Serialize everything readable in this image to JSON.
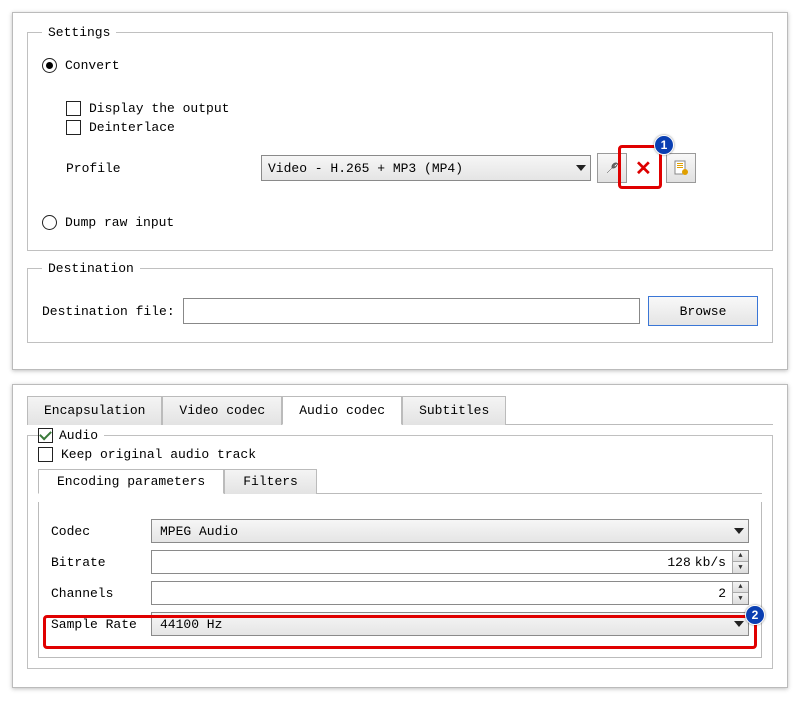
{
  "settings": {
    "legend": "Settings",
    "convert_label": "Convert",
    "display_output_label": "Display the output",
    "deinterlace_label": "Deinterlace",
    "profile_label": "Profile",
    "profile_value": "Video - H.265 + MP3 (MP4)",
    "dump_raw_label": "Dump raw input",
    "wrench_icon": "🔧",
    "delete_icon": "✕",
    "new_icon": "📄",
    "callout1": "1"
  },
  "destination": {
    "legend": "Destination",
    "file_label": "Destination file:",
    "file_value": "",
    "browse_label": "Browse"
  },
  "codec_panel": {
    "tabs": {
      "encapsulation": "Encapsulation",
      "video_codec": "Video codec",
      "audio_codec": "Audio codec",
      "subtitles": "Subtitles"
    },
    "audio_group_label": "Audio",
    "keep_original_label": "Keep original audio track",
    "subtabs": {
      "encoding_params": "Encoding parameters",
      "filters": "Filters"
    },
    "fields": {
      "codec_label": "Codec",
      "codec_value": "MPEG Audio",
      "bitrate_label": "Bitrate",
      "bitrate_value": "128",
      "bitrate_unit": "kb/s",
      "channels_label": "Channels",
      "channels_value": "2",
      "samplerate_label": "Sample Rate",
      "samplerate_value": "44100 Hz"
    },
    "callout2": "2"
  }
}
